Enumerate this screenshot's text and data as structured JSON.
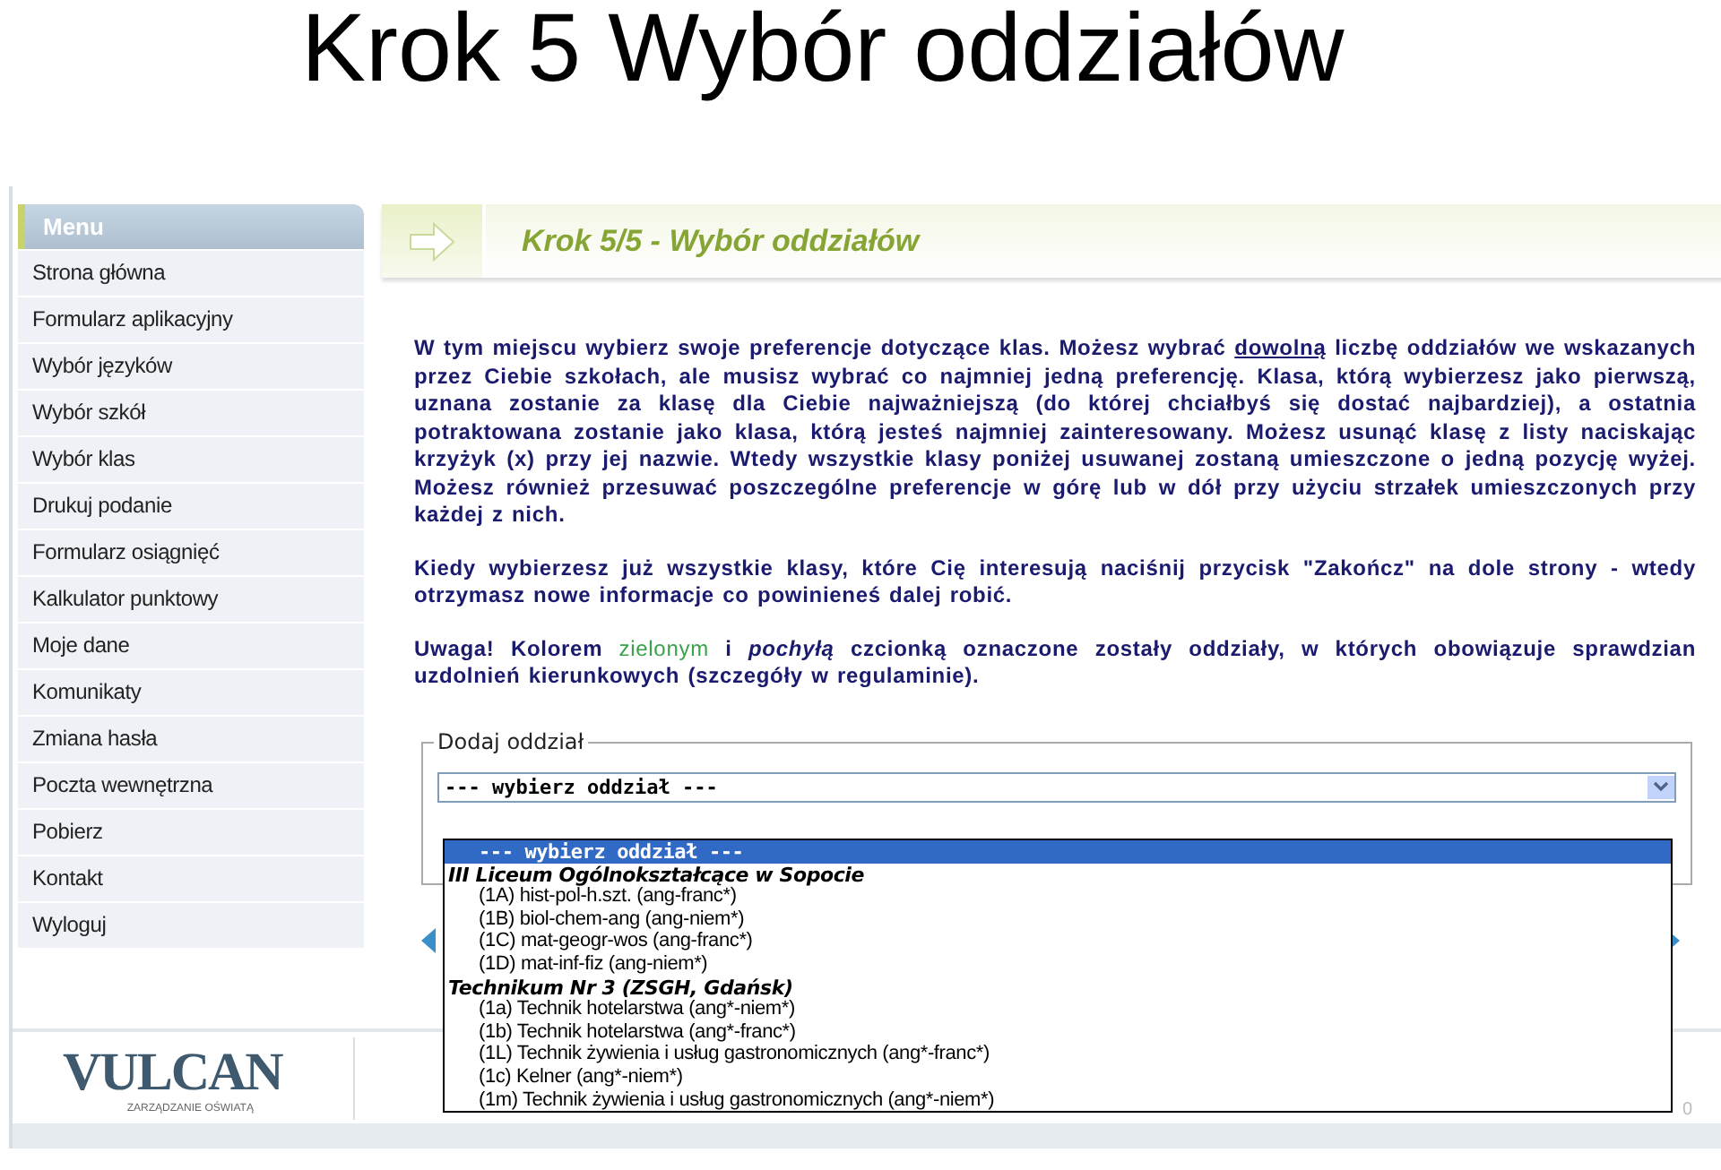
{
  "slide_title": "Krok 5 Wybór oddziałów",
  "menu": {
    "title": "Menu",
    "items": [
      {
        "label": "Strona główna"
      },
      {
        "label": "Formularz aplikacyjny"
      },
      {
        "label": "Wybór języków"
      },
      {
        "label": "Wybór szkół"
      },
      {
        "label": "Wybór klas"
      },
      {
        "label": "Drukuj podanie"
      },
      {
        "label": "Formularz osiągnięć"
      },
      {
        "label": "Kalkulator punktowy"
      },
      {
        "label": "Moje dane"
      },
      {
        "label": "Komunikaty"
      },
      {
        "label": "Zmiana hasła"
      },
      {
        "label": "Poczta wewnętrzna"
      },
      {
        "label": "Pobierz"
      },
      {
        "label": "Kontakt"
      },
      {
        "label": "Wyloguj"
      }
    ]
  },
  "page_title": "Krok 5/5 - Wybór oddziałów",
  "paragraphs": [
    [
      {
        "text": "W tym miejscu wybierz swoje preferencje dotyczące klas. Możesz wybrać ",
        "kind": "text"
      },
      {
        "text": "dowolną",
        "kind": "link"
      },
      {
        "text": " liczbę oddziałów we wskazanych przez Ciebie szkołach, ale musisz wybrać co najmniej jedną preferencję. Klasa, którą wybierzesz jako pierwszą, uznana zostanie za klasę dla Ciebie najważniejszą (do której chciałbyś się dostać najbardziej), a ostatnia potraktowana zostanie jako klasa, którą jesteś najmniej zainteresowany. Możesz usunąć klasę z listy naciskając krzyżyk (x) przy jej nazwie. Wtedy wszystkie klasy poniżej usuwanej zostaną umieszczone o jedną pozycję wyżej. Możesz również przesuwać poszczególne preferencje w górę lub w dół przy użyciu strzałek umieszczonych przy każdej z nich.",
        "kind": "text"
      }
    ],
    [
      {
        "text": "Kiedy wybierzesz już wszystkie klasy, które Cię interesują naciśnij przycisk \"Zakończ\" na dole strony - wtedy otrzymasz nowe informacje co powinieneś dalej robić.",
        "kind": "text"
      }
    ],
    [
      {
        "text": "Uwaga! Kolorem ",
        "kind": "text"
      },
      {
        "text": "zielonym",
        "kind": "highlight"
      },
      {
        "text": " i *pochyłą* czcionką oznaczone zostały oddziały, w których obowiązuje sprawdzian uzdolnień kierunkowych (szczegóły w regulaminie).",
        "kind": "text"
      }
    ]
  ],
  "add_section": {
    "legend": "Dodaj oddział",
    "select_value": "--- wybierz oddział ---",
    "options": [
      {
        "kind": "option",
        "label": "--- wybierz oddział ---",
        "selected": true
      },
      {
        "kind": "group",
        "label": "III Liceum Ogólnokształcące w Sopocie",
        "selected": false
      },
      {
        "kind": "option",
        "label": "(1A) hist-pol-h.szt. (ang-franc*)",
        "selected": false
      },
      {
        "kind": "option",
        "label": "(1B) biol-chem-ang (ang-niem*)",
        "selected": false
      },
      {
        "kind": "option",
        "label": "(1C) mat-geogr-wos (ang-franc*)",
        "selected": false
      },
      {
        "kind": "option",
        "label": "(1D) mat-inf-fiz (ang-niem*)",
        "selected": false
      },
      {
        "kind": "group",
        "label": "Technikum Nr 3 (ZSGH, Gdańsk)",
        "selected": false
      },
      {
        "kind": "option",
        "label": "(1a) Technik hotelarstwa (ang*-niem*)",
        "selected": false
      },
      {
        "kind": "option",
        "label": "(1b) Technik hotelarstwa (ang*-franc*)",
        "selected": false
      },
      {
        "kind": "option",
        "label": "(1L) Technik żywienia i usług gastronomicznych (ang*-franc*)",
        "selected": false
      },
      {
        "kind": "option",
        "label": "(1c) Kelner (ang*-niem*)",
        "selected": false
      },
      {
        "kind": "option",
        "label": "(1m) Technik żywienia i usług gastronomicznych (ang*-niem*)",
        "selected": false
      }
    ]
  },
  "footer": {
    "logo": "VULCAN",
    "tagline": "ZARZĄDZANIE OŚWIATĄ",
    "page_number": "0"
  }
}
